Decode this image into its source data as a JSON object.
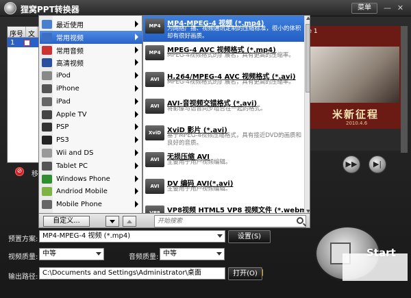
{
  "app": {
    "title": "狸窝PPT转换器",
    "menu_label": "菜单"
  },
  "window_controls": {
    "minimize": "—",
    "close": "✕"
  },
  "file_list": {
    "headers": [
      "序号",
      "文"
    ],
    "rows": [
      {
        "index": "1"
      }
    ]
  },
  "remove_label": "移",
  "preview": {
    "top_text": "le 1",
    "banner_text": "米新征程",
    "date": "2010.4.6"
  },
  "menu": {
    "items": [
      {
        "label": "最近使用",
        "icon": "clock-icon",
        "color": "#4a7fd0"
      },
      {
        "label": "常用视频",
        "icon": "film-icon",
        "color": "#3b6fc4",
        "active": true
      },
      {
        "label": "常用音频",
        "icon": "music-icon",
        "color": "#cc3333"
      },
      {
        "label": "高清视频",
        "icon": "hd-icon",
        "color": "#2a4fa0"
      },
      {
        "label": "iPod",
        "icon": "ipod-icon",
        "color": "#888888"
      },
      {
        "label": "iPhone",
        "icon": "iphone-icon",
        "color": "#555555"
      },
      {
        "label": "iPad",
        "icon": "ipad-icon",
        "color": "#666666"
      },
      {
        "label": "Apple TV",
        "icon": "appletv-icon",
        "color": "#444444"
      },
      {
        "label": "PSP",
        "icon": "psp-icon",
        "color": "#333333"
      },
      {
        "label": "PS3",
        "icon": "ps3-icon",
        "color": "#222222"
      },
      {
        "label": "Wii and DS",
        "icon": "wii-icon",
        "color": "#999999"
      },
      {
        "label": "Tablet PC",
        "icon": "tablet-icon",
        "color": "#555555"
      },
      {
        "label": "Windows Phone",
        "icon": "windows-icon",
        "color": "#2f8f2f"
      },
      {
        "label": "Andriod Mobile",
        "icon": "android-icon",
        "color": "#7cb342"
      },
      {
        "label": "Mobile Phone",
        "icon": "phone-icon",
        "color": "#666666"
      }
    ]
  },
  "submenu": {
    "items": [
      {
        "icon_text": "MP4",
        "title": "MP4-MPEG-4 视频 (*.mp4)",
        "desc": "为网络广播、视频通讯定制的压缩标准，很小的体积却有很好画质。",
        "active": true
      },
      {
        "icon_text": "MP4",
        "title": "MPEG-4 AVC 视频格式 (*.mp4)",
        "desc": "MPEG-4视频格式的扩展名，具有更高的压缩率。"
      },
      {
        "icon_text": "AVI",
        "title": "H.264/MPEG-4 AVC 视频格式 (*.avi)",
        "desc": "MPEG-4视频格式的扩展名，具有更高的压缩率。"
      },
      {
        "icon_text": "AVI",
        "title": "AVI-音视频交错格式 (*.avi)",
        "desc": "将影像与语音同步组合在一起的格式。"
      },
      {
        "icon_text": "XviD",
        "title": "XviD 影片 (*.avi)",
        "desc": "基于MPEG-4视频压缩格式，具有接近DVD的画质和良好的音质。"
      },
      {
        "icon_text": "AVI",
        "title": "无损压缩 AVI",
        "desc": "主要用于用户视频编辑。"
      },
      {
        "icon_text": "AVI",
        "title": "DV 编码 AVI(*.avi)",
        "desc": "主要用于用户视频编辑。"
      },
      {
        "icon_text": "VP8",
        "title": "VP8视频 HTML5 VP8 视频文件 (*.webm)",
        "desc": ""
      }
    ]
  },
  "popup_bottom": {
    "custom_label": "自定义...",
    "search_placeholder": "开始搜索"
  },
  "settings": {
    "preset_label": "预置方案:",
    "preset_value": "MP4-MPEG-4 视频 (*.mp4)",
    "settings_button": "设置(S)",
    "video_quality_label": "视频质量:",
    "video_quality_value": "中等",
    "audio_quality_label": "音频质量:",
    "audio_quality_value": "中等",
    "output_label": "输出路径:",
    "output_value": "C:\\Documents and Settings\\Administrator\\桌面",
    "open_button": "打开(O)",
    "start_label": "Start"
  }
}
